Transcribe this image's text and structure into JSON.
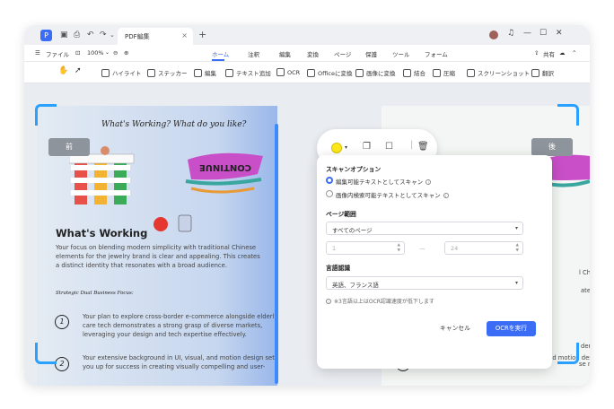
{
  "window": {
    "tab_title": "PDF編集",
    "tab_close": "×",
    "new_tab": "+"
  },
  "menu": {
    "file": "ファイル",
    "zoom": "100%",
    "tabs": [
      "ホーム",
      "注釈",
      "編集",
      "変換",
      "ページ",
      "保護",
      "ツール",
      "フォーム"
    ],
    "share": "共有"
  },
  "toolbar": {
    "tools": [
      "ハイライト",
      "ステッカー",
      "編集",
      "テキスト追加",
      "OCR",
      "Officeに変換",
      "画像に変換",
      "結合",
      "圧縮",
      "スクリーンショット",
      "翻訳"
    ]
  },
  "compare": {
    "before": "前",
    "after": "後"
  },
  "document": {
    "script_heading": "What's Working? What do you like?",
    "sign_text": "CONTINUE",
    "section_title": "What's Working",
    "intro_para": "Your focus on blending modern simplicity with traditional Chinese elements for the jewelry brand is clear and appealing. This creates a distinct identity that resonates with a broad audience.",
    "strategic_label": "Strategic Dual Business Focus:",
    "item1_num": "1",
    "item1_text": "Your plan to explore cross-border e-commerce alongside elderly care tech demonstrates a strong grasp of diverse markets, leveraging your design and tech expertise effectively.",
    "item2_num": "2",
    "item2_text": "Your extensive background in UI, visual, and motion design sets you up for success in creating visually compelling and user-",
    "right_fragment_1": "l Chinese",
    "right_fragment_2": "ates a",
    "right_fragment_3": "derly",
    "right_fragment_4": "se markets,",
    "right_fragment_5": "Your extensive background in UI, visual, and motion design sets"
  },
  "ocr_panel": {
    "scan_options_label": "スキャンオプション",
    "option1": "編集可能テキストとしてスキャン",
    "option2": "画像内検索可能テキストとしてスキャン",
    "page_range_label": "ページ範囲",
    "page_range_value": "すべてのページ",
    "from_page": "1",
    "to_page": "24",
    "dash": "—",
    "language_label": "言語認識",
    "language_value": "英語、フランス語",
    "note": "※3言語以上はOCR認識速度が低下します",
    "cancel_label": "キャンセル",
    "run_label": "OCRを実行"
  },
  "colors": {
    "accent": "#3b6cf6",
    "highlight_yellow": "#ffe81a",
    "compare_line": "#3b8bff"
  },
  "icons": [
    "app-logo-icon",
    "hand-icon",
    "cursor-icon",
    "highlight-icon",
    "sticker-icon",
    "edit-icon",
    "add-text-icon",
    "ocr-icon",
    "office-icon",
    "image-icon",
    "merge-icon",
    "compress-icon",
    "screenshot-icon",
    "translate-icon",
    "copy-icon",
    "comment-icon",
    "trash-icon"
  ]
}
